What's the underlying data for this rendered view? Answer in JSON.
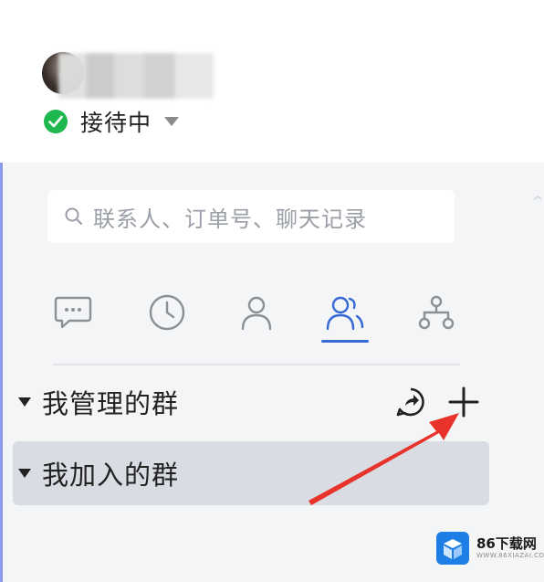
{
  "profile": {
    "status_text": "接待中"
  },
  "search": {
    "placeholder": "联系人、订单号、聊天记录"
  },
  "tabs": [
    {
      "icon": "chat-bubble-icon"
    },
    {
      "icon": "clock-icon"
    },
    {
      "icon": "person-icon"
    },
    {
      "icon": "group-icon",
      "active": true
    },
    {
      "icon": "org-chart-icon"
    }
  ],
  "groups": [
    {
      "label": "我管理的群",
      "actions": [
        "share-icon",
        "plus-icon"
      ]
    },
    {
      "label": "我加入的群",
      "selected": true
    }
  ],
  "watermark": {
    "title": "86下载网",
    "subtitle": "WWW.86XIAZAI.COM"
  },
  "colors": {
    "accent": "#3569d6",
    "status_green": "#1fb84f",
    "annotation_arrow": "#e8332a"
  }
}
